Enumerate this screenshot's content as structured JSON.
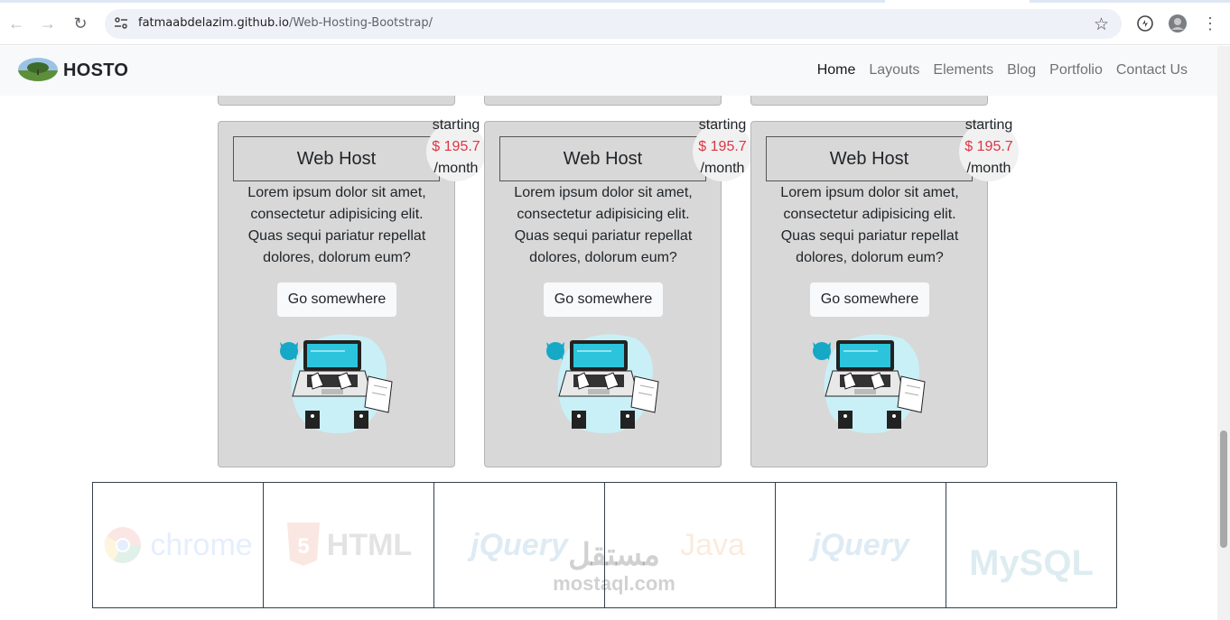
{
  "browser": {
    "url_host": "fatmaabdelazim.github.io",
    "url_path": "/Web-Hosting-Bootstrap/"
  },
  "navbar": {
    "brand": "HOSTO",
    "items": [
      {
        "label": "Home",
        "active": true
      },
      {
        "label": "Layouts"
      },
      {
        "label": "Elements"
      },
      {
        "label": "Blog"
      },
      {
        "label": "Portfolio"
      },
      {
        "label": "Contact Us"
      }
    ]
  },
  "cards": [
    {
      "title": "Web Host",
      "price_prefix": "starting",
      "price": "$ 195.7",
      "price_suffix": "/month",
      "description": "Lorem ipsum dolor sit amet, consectetur adipisicing elit. Quas sequi pariatur repellat dolores, dolorum eum?",
      "button": "Go somewhere"
    },
    {
      "title": "Web Host",
      "price_prefix": "starting",
      "price": "$ 195.7",
      "price_suffix": "/month",
      "description": "Lorem ipsum dolor sit amet, consectetur adipisicing elit. Quas sequi pariatur repellat dolores, dolorum eum?",
      "button": "Go somewhere"
    },
    {
      "title": "Web Host",
      "price_prefix": "starting",
      "price": "$ 195.7",
      "price_suffix": "/month",
      "description": "Lorem ipsum dolor sit amet, consectetur adipisicing elit. Quas sequi pariatur repellat dolores, dolorum eum?",
      "button": "Go somewhere"
    }
  ],
  "logos": [
    {
      "name": "chrome",
      "text": "chrome",
      "color": "#4285f4"
    },
    {
      "name": "html",
      "text": "HTML",
      "color": "#e34f26"
    },
    {
      "name": "jquery",
      "text": "jQuery",
      "color": "#0769ad"
    },
    {
      "name": "java",
      "text": "Java",
      "color": "#e76f00"
    },
    {
      "name": "jquery",
      "text": "jQuery",
      "color": "#0769ad"
    },
    {
      "name": "mysql",
      "text": "MySQL",
      "color": "#00758f"
    }
  ],
  "watermark": {
    "arabic": "مستقل",
    "latin": "mostaql.com"
  },
  "colors": {
    "price": "#dc3545",
    "card_bg": "#d8d8d8",
    "navbar_bg": "#f8f9fa"
  }
}
